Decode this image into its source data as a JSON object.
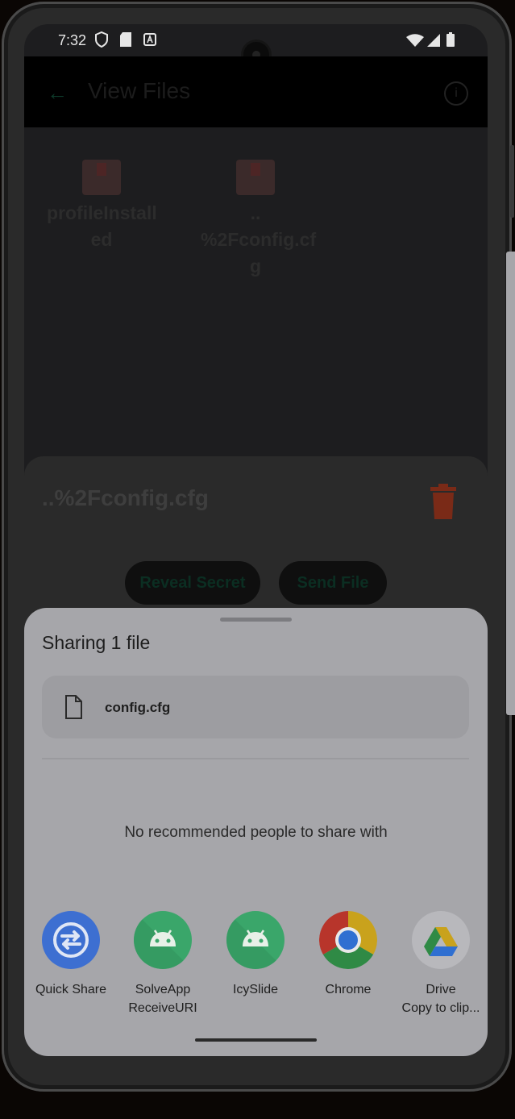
{
  "status_bar": {
    "time": "7:32"
  },
  "app_bar": {
    "title": "View Files"
  },
  "files": [
    {
      "name": "profileInstalled"
    },
    {
      "name": "..%2Fconfig.cfg"
    }
  ],
  "file_lines": {
    "profile": [
      "profileInstall",
      "ed"
    ],
    "config": [
      "..",
      "%2Fconfig.cf",
      "g"
    ]
  },
  "detail": {
    "filename": "..%2Fconfig.cfg",
    "reveal_label": "Reveal Secret",
    "send_label": "Send File"
  },
  "share_sheet": {
    "title": "Sharing 1 file",
    "file_name": "config.cfg",
    "no_recommendations": "No recommended people to share with",
    "targets": [
      {
        "label": "Quick Share",
        "sublabel": "",
        "icon": "quick-share-icon"
      },
      {
        "label": "SolveApp",
        "sublabel": "ReceiveURI",
        "icon": "android-icon"
      },
      {
        "label": "IcySlide",
        "sublabel": "",
        "icon": "android-icon"
      },
      {
        "label": "Chrome",
        "sublabel": "",
        "icon": "chrome-icon"
      },
      {
        "label": "Drive",
        "sublabel": "Copy to clip...",
        "icon": "drive-icon"
      }
    ]
  },
  "colors": {
    "sheet_bg": "#a6a6aa",
    "quick_share": "#3d6fd1",
    "android_green": "#3aa66a",
    "trash_red": "#7a2a17"
  }
}
